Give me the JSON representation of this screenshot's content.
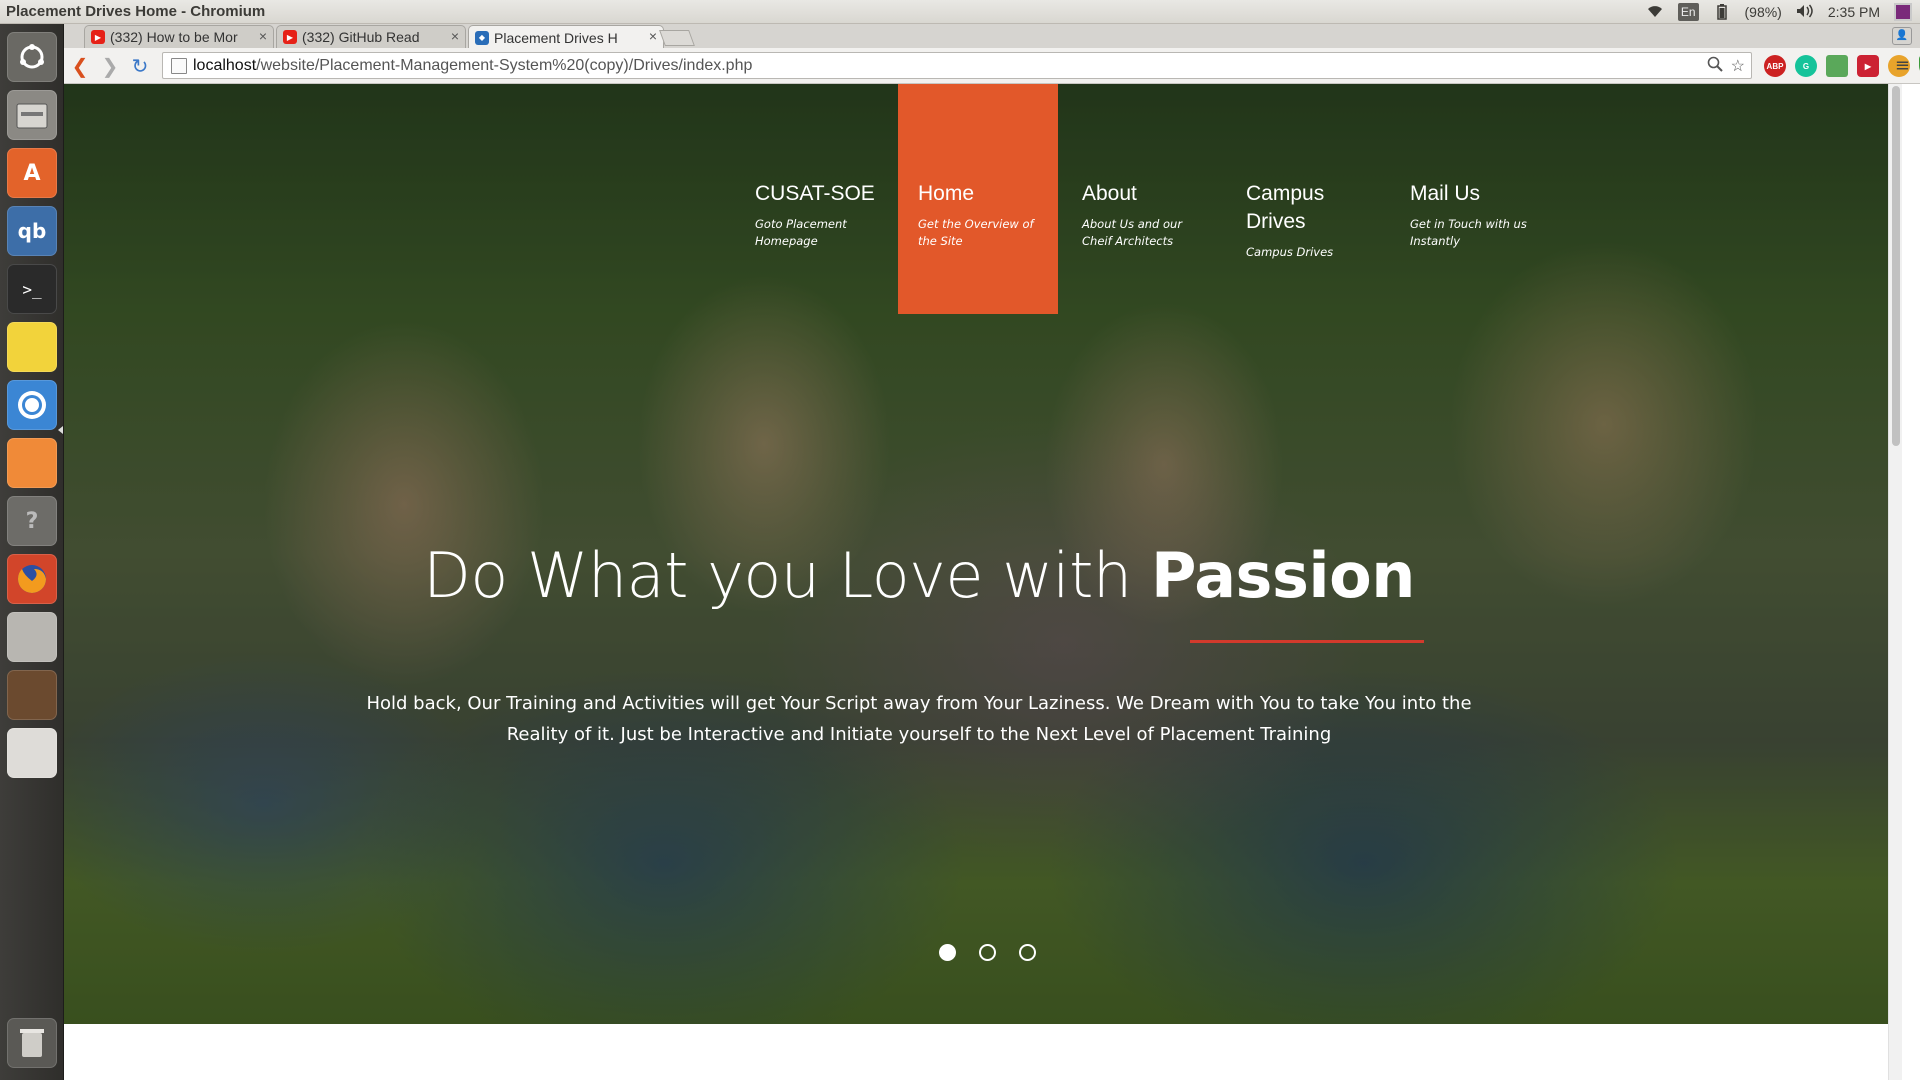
{
  "window": {
    "title": "Placement Drives Home - Chromium"
  },
  "indicators": {
    "lang": "En",
    "battery": "(98%)",
    "clock": "2:35 PM"
  },
  "launcher": [
    {
      "name": "dash-icon"
    },
    {
      "name": "files-icon"
    },
    {
      "name": "software-center-icon"
    },
    {
      "name": "qbittorrent-icon"
    },
    {
      "name": "terminal-icon"
    },
    {
      "name": "sticky-notes-icon"
    },
    {
      "name": "chromium-icon"
    },
    {
      "name": "app-icon"
    },
    {
      "name": "help-icon"
    },
    {
      "name": "firefox-icon"
    },
    {
      "name": "system-settings-icon"
    },
    {
      "name": "library-icon"
    },
    {
      "name": "installer-icon"
    },
    {
      "name": "trash-icon"
    }
  ],
  "tabs": [
    {
      "label": "(332) How to be Mor"
    },
    {
      "label": "(332) GitHub Read"
    },
    {
      "label": "Placement Drives H"
    }
  ],
  "omnibox": {
    "host": "localhost",
    "path": "/website/Placement-Management-System%20(copy)/Drives/index.php"
  },
  "extensions": [
    {
      "name": "adblock-icon",
      "label": "ABP",
      "color": "#cc2222"
    },
    {
      "name": "grammarly-icon",
      "label": "G",
      "color": "#15c39a"
    },
    {
      "name": "inbox-icon",
      "label": "",
      "color": "#5aa85a"
    },
    {
      "name": "video-icon",
      "label": "▶",
      "color": "#cc2233"
    },
    {
      "name": "color-picker-icon",
      "label": "",
      "color": "#e8a32b"
    },
    {
      "name": "shield-icon",
      "label": "",
      "color": "#3a9a3a"
    }
  ],
  "nav": [
    {
      "title": "CUSAT-SOE",
      "subtitle": "Goto Placement Homepage"
    },
    {
      "title": "Home",
      "subtitle": "Get the Overview of the Site"
    },
    {
      "title": "About",
      "subtitle": "About Us and our Cheif Architects"
    },
    {
      "title": "Campus Drives",
      "subtitle": "Campus Drives"
    },
    {
      "title": "Mail Us",
      "subtitle": "Get in Touch with us Instantly"
    }
  ],
  "hero": {
    "heading_light": "Do What you Love with ",
    "heading_bold": "Passion",
    "text": "Hold back, Our Training and Activities will get Your Script away from Your Laziness. We Dream with You to take You into the Reality of it. Just be Interactive and Initiate yourself to the Next Level of Placement Training",
    "active_slide": 1,
    "slide_count": 3
  },
  "colors": {
    "accent": "#e2582a",
    "underline": "#d23a2c"
  }
}
